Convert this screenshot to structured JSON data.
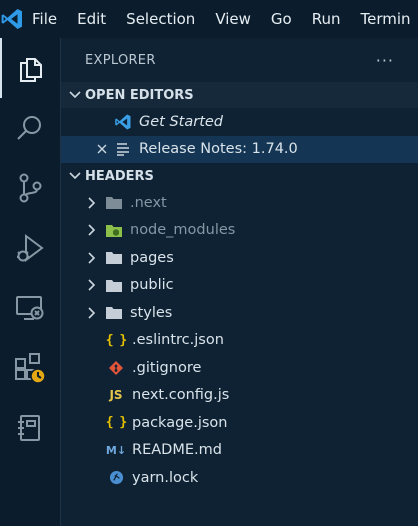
{
  "menu": [
    "File",
    "Edit",
    "Selection",
    "View",
    "Go",
    "Run",
    "Termin"
  ],
  "explorer": {
    "title": "EXPLORER",
    "more": "···"
  },
  "open_editors": {
    "header": "OPEN EDITORS",
    "items": [
      {
        "label": "Get Started",
        "icon": "vscode-icon"
      },
      {
        "label": "Release Notes: 1.74.0",
        "icon": "document-icon",
        "selected": true
      }
    ]
  },
  "folder": {
    "header": "HEADERS",
    "items": [
      {
        "label": ".next",
        "type": "folder",
        "dim": true
      },
      {
        "label": "node_modules",
        "type": "folder-node",
        "dim": true
      },
      {
        "label": "pages",
        "type": "folder"
      },
      {
        "label": "public",
        "type": "folder"
      },
      {
        "label": "styles",
        "type": "folder"
      },
      {
        "label": ".eslintrc.json",
        "type": "json"
      },
      {
        "label": ".gitignore",
        "type": "git"
      },
      {
        "label": "next.config.js",
        "type": "js"
      },
      {
        "label": "package.json",
        "type": "json"
      },
      {
        "label": "README.md",
        "type": "md"
      },
      {
        "label": "yarn.lock",
        "type": "yarn"
      }
    ]
  },
  "icons": {
    "json_glyph": "{ }",
    "js_glyph": "JS",
    "md_glyph": "M↓"
  },
  "colors": {
    "accent": "#3a9ee6",
    "json": "#e5c100",
    "js": "#e3c54a",
    "git": "#e2553a",
    "md": "#6fa8dc",
    "yarn": "#4a8fd1",
    "node": "#8dc04a"
  }
}
